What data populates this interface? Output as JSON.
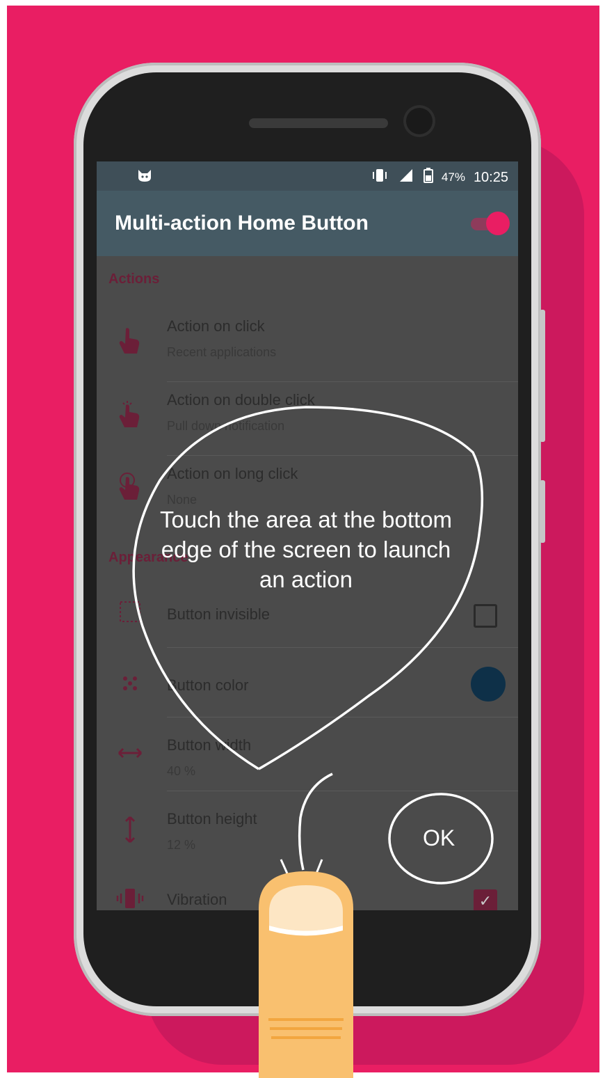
{
  "status_bar": {
    "notification_icon": "cat-icon",
    "icons": [
      "vibrate-icon",
      "signal-icon",
      "battery-icon"
    ],
    "battery": "47%",
    "time": "10:25"
  },
  "app_bar": {
    "title": "Multi-action Home Button",
    "master_switch_on": true
  },
  "sections": {
    "actions": {
      "header": "Actions",
      "items": [
        {
          "title": "Action on click",
          "summary": "Recent applications",
          "icon": "tap-icon"
        },
        {
          "title": "Action on double click",
          "summary": "Pull down notification",
          "icon": "double-tap-icon"
        },
        {
          "title": "Action on long click",
          "summary": "None",
          "icon": "long-press-icon"
        }
      ]
    },
    "appearance": {
      "header": "Appearance",
      "items": [
        {
          "title": "Button invisible",
          "icon": "dotted-square-icon",
          "checked": false
        },
        {
          "title": "Button color",
          "icon": "palette-icon",
          "color": "#0e3048"
        },
        {
          "title": "Button width",
          "summary": "40 %",
          "icon": "horizontal-arrows-icon"
        },
        {
          "title": "Button height",
          "summary": "12 %",
          "icon": "vertical-arrows-icon"
        },
        {
          "title": "Vibration",
          "icon": "vibrate-icon",
          "checked": true
        }
      ]
    }
  },
  "tutorial": {
    "hint": "Touch the area at the bottom edge of the screen to launch an action",
    "ok_label": "OK"
  },
  "colors": {
    "background": "#e91e63",
    "accent": "#e91e63",
    "app_bar": "#455a64",
    "status_bar": "#3f4f58"
  }
}
